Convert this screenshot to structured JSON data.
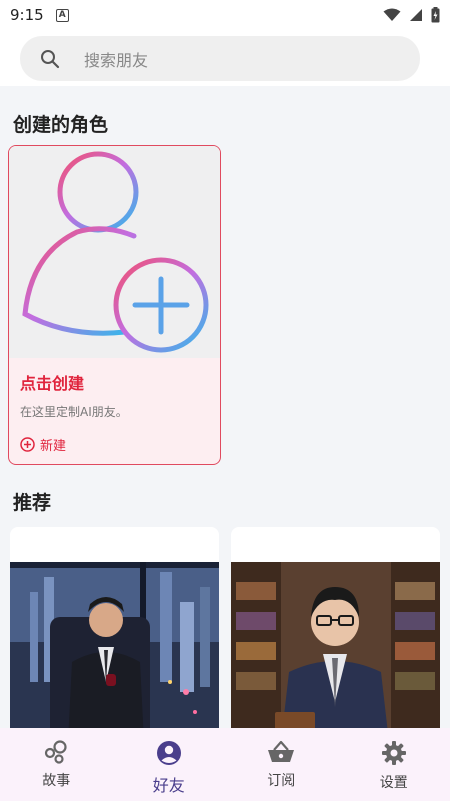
{
  "status_bar": {
    "time": "9:15",
    "notification_icon": "A"
  },
  "search": {
    "placeholder": "搜索朋友"
  },
  "sections": {
    "created_title": "创建的角色",
    "recommended_title": "推荐"
  },
  "create_card": {
    "title": "点击创建",
    "description": "在这里定制AI朋友。",
    "new_label": "新建"
  },
  "recommended": [
    {
      "name": "",
      "image_desc": "businessman-in-suit-with-wine-city-night"
    },
    {
      "name": "",
      "image_desc": "man-with-glasses-library"
    }
  ],
  "bottom_nav": {
    "items": [
      {
        "label": "故事",
        "icon": "story-icon",
        "active": false
      },
      {
        "label": "好友",
        "icon": "friend-icon",
        "active": true
      },
      {
        "label": "订阅",
        "icon": "basket-icon",
        "active": false
      },
      {
        "label": "设置",
        "icon": "gear-icon",
        "active": false
      }
    ]
  },
  "colors": {
    "accent_red": "#e0243d",
    "nav_active": "#4a3e8c",
    "nav_bg": "#fbf2fb"
  }
}
